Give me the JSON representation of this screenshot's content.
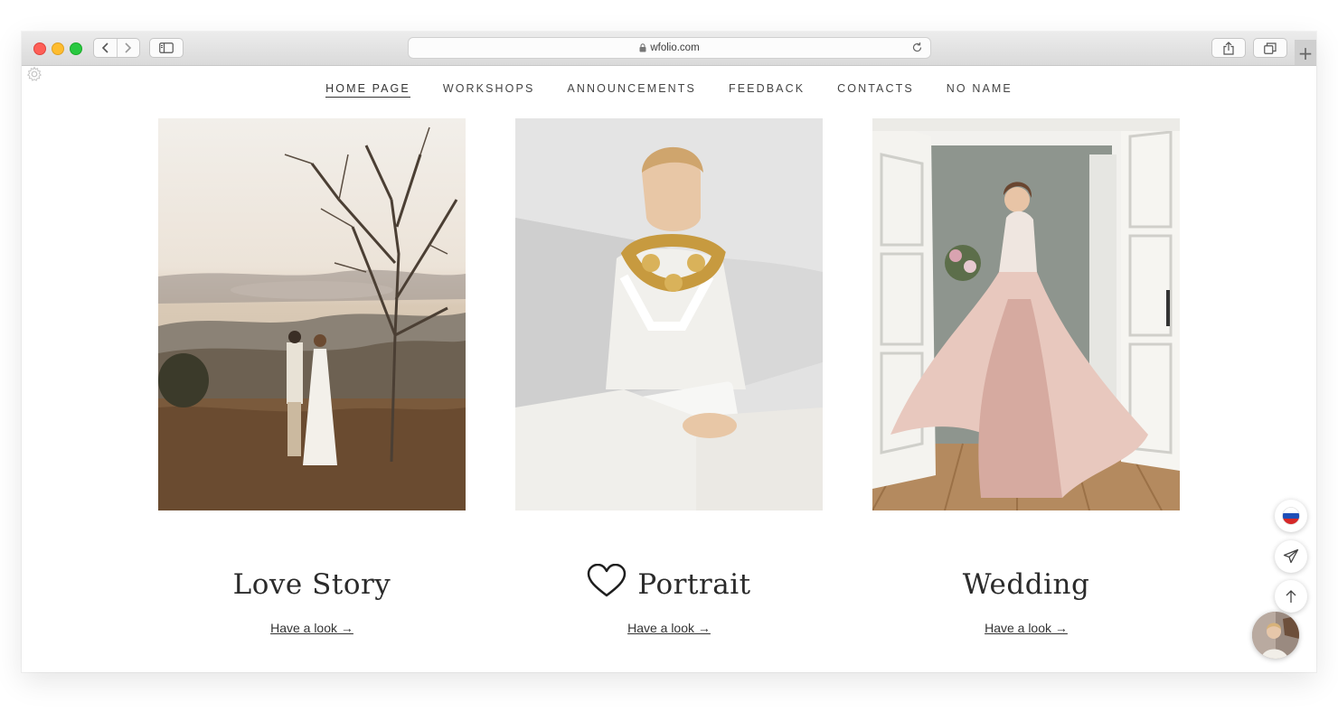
{
  "browser": {
    "url": "wfolio.com",
    "plus_label": "+"
  },
  "nav": {
    "items": [
      {
        "label": "HOME PAGE",
        "active": true
      },
      {
        "label": "WORKSHOPS"
      },
      {
        "label": "ANNOUNCEMENTS"
      },
      {
        "label": "FEEDBACK"
      },
      {
        "label": "CONTACTS"
      },
      {
        "label": "NO NAME"
      }
    ]
  },
  "cards": [
    {
      "title": "Love Story",
      "link": "Have a look →"
    },
    {
      "title": "Portrait",
      "link": "Have a look →"
    },
    {
      "title": "Wedding",
      "link": "Have a look →"
    }
  ],
  "colors": {
    "text": "#2b2b2b",
    "flag_white": "#ffffff",
    "flag_blue": "#1f4fb8",
    "flag_red": "#d62828"
  }
}
